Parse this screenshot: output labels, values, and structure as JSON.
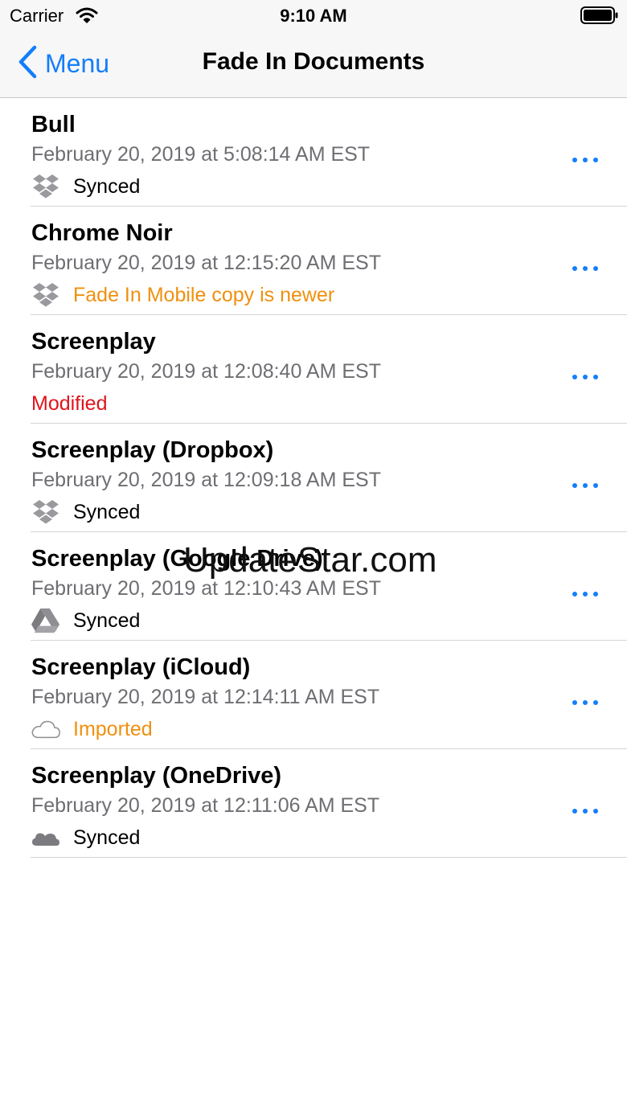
{
  "status_bar": {
    "carrier": "Carrier",
    "time": "9:10 AM"
  },
  "nav": {
    "back_label": "Menu",
    "title": "Fade In Documents"
  },
  "colors": {
    "accent": "#147efb",
    "orange": "#f0900e",
    "red": "#e0141c",
    "text_default": "#000000",
    "gray": "#6e6e73"
  },
  "documents": [
    {
      "name": "Bull",
      "date": "February 20, 2019 at 5:08:14 AM EST",
      "status": "Synced",
      "status_color": "#000000",
      "service_icon": "dropbox-icon"
    },
    {
      "name": "Chrome Noir",
      "date": "February 20, 2019 at 12:15:20 AM EST",
      "status": "Fade In Mobile copy is newer",
      "status_color": "#f0900e",
      "service_icon": "dropbox-icon"
    },
    {
      "name": "Screenplay",
      "date": "February 20, 2019 at 12:08:40 AM EST",
      "status": "Modified",
      "status_color": "#e0141c",
      "service_icon": ""
    },
    {
      "name": "Screenplay (Dropbox)",
      "date": "February 20, 2019 at 12:09:18 AM EST",
      "status": "Synced",
      "status_color": "#000000",
      "service_icon": "dropbox-icon"
    },
    {
      "name": "Screenplay (Google Drive)",
      "date": "February 20, 2019 at 12:10:43 AM EST",
      "status": "Synced",
      "status_color": "#000000",
      "service_icon": "google-drive-icon"
    },
    {
      "name": "Screenplay (iCloud)",
      "date": "February 20, 2019 at 12:14:11 AM EST",
      "status": "Imported",
      "status_color": "#f0900e",
      "service_icon": "icloud-icon"
    },
    {
      "name": "Screenplay (OneDrive)",
      "date": "February 20, 2019 at 12:11:06 AM EST",
      "status": "Synced",
      "status_color": "#000000",
      "service_icon": "onedrive-icon"
    }
  ],
  "watermark": "UpdateStar.com"
}
